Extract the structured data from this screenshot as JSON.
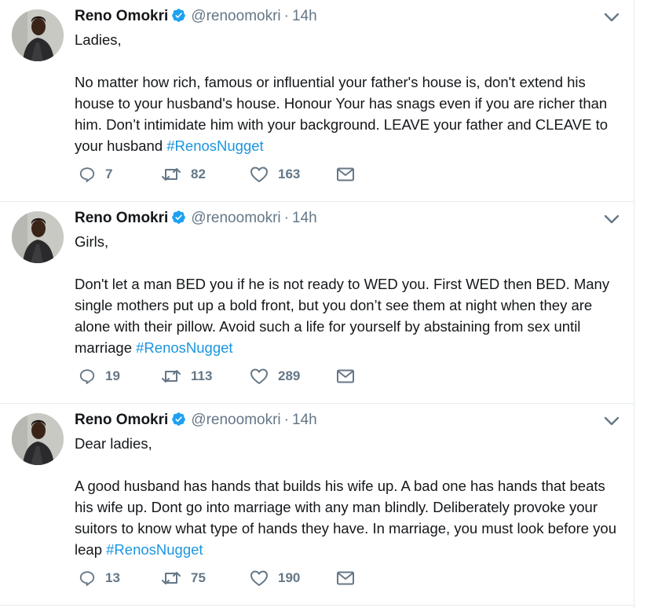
{
  "colors": {
    "primary_text": "#14171a",
    "secondary_text": "#657786",
    "link": "#1b95e0",
    "verified_badge": "#1da1f2",
    "divider": "#e6ecf0"
  },
  "icons": {
    "verified": "verified-badge-icon",
    "caret": "chevron-down-icon",
    "reply": "reply-icon",
    "retweet": "retweet-icon",
    "like": "heart-icon",
    "dm": "envelope-icon"
  },
  "tweets": [
    {
      "author": {
        "name": "Reno Omokri",
        "handle": "@renoomokri",
        "time": "14h",
        "verified": true
      },
      "salutation": "Ladies,",
      "text": "No matter how rich, famous or influential your father's house is, don't extend his house to your husband's house. Honour Your has snags even if you are richer than him. Don’t intimidate him with your background. LEAVE your father and CLEAVE to your husband ",
      "hashtag": "#RenosNugget",
      "stats": {
        "replies": "7",
        "retweets": "82",
        "likes": "163"
      }
    },
    {
      "author": {
        "name": "Reno Omokri",
        "handle": "@renoomokri",
        "time": "14h",
        "verified": true
      },
      "salutation": "Girls,",
      "text": "Don't let a man BED you if he is not ready to WED you. First WED then BED. Many single mothers put up a bold front, but you don’t see them at night when they are alone with their pillow. Avoid such a life for yourself by abstaining from sex until marriage ",
      "hashtag": "#RenosNugget",
      "stats": {
        "replies": "19",
        "retweets": "113",
        "likes": "289"
      }
    },
    {
      "author": {
        "name": "Reno Omokri",
        "handle": "@renoomokri",
        "time": "14h",
        "verified": true
      },
      "salutation": "Dear ladies,",
      "text": "A good husband has hands that builds his wife up. A bad one has hands that beats his wife up. Dont go into marriage with any man blindly. Deliberately provoke your suitors to know what type of hands they have. In marriage, you must look before you leap ",
      "hashtag": "#RenosNugget",
      "stats": {
        "replies": "13",
        "retweets": "75",
        "likes": "190"
      }
    }
  ]
}
